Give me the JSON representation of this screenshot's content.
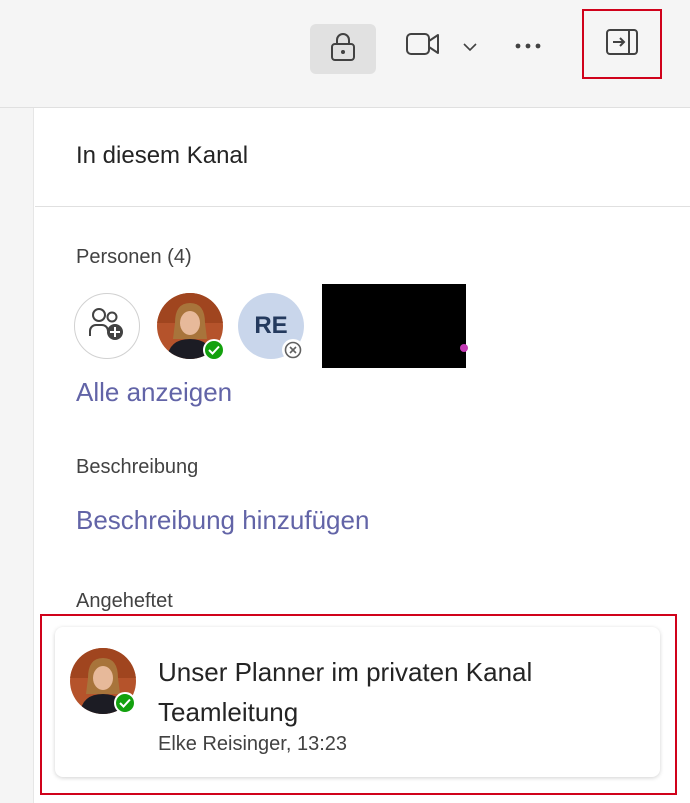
{
  "toolbar": {
    "lock_icon": "lock-icon",
    "video_icon": "video-camera-icon",
    "chevron_icon": "chevron-down-icon",
    "more_icon": "more-icon",
    "collapse_icon": "collapse-panel-icon"
  },
  "panel": {
    "title": "In diesem Kanal"
  },
  "people": {
    "label": "Personen (4)",
    "members": [
      {
        "initials": "",
        "presence": "available"
      },
      {
        "initials": "RE",
        "presence": "offline"
      }
    ],
    "show_all": "Alle anzeigen"
  },
  "description": {
    "label": "Beschreibung",
    "add_link": "Beschreibung hinzufügen"
  },
  "pinned": {
    "label": "Angeheftet",
    "items": [
      {
        "title": "Unser Planner im privaten Kanal Teamleitung",
        "meta": "Elke Reisinger, 13:23"
      }
    ]
  },
  "colors": {
    "accent": "#6264a7",
    "presence_available": "#13a10e",
    "highlight": "#d0021b"
  }
}
